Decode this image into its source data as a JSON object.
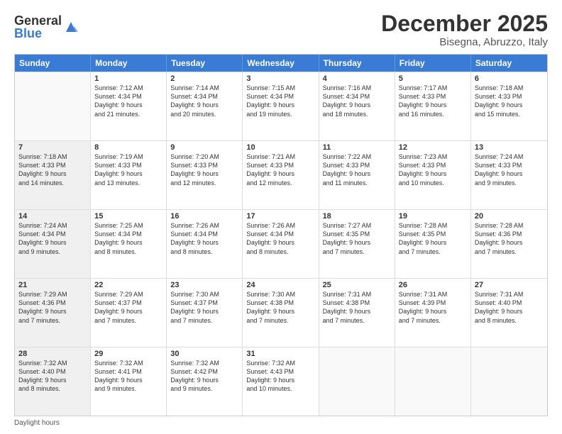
{
  "logo": {
    "general": "General",
    "blue": "Blue"
  },
  "title": "December 2025",
  "subtitle": "Bisegna, Abruzzo, Italy",
  "header_days": [
    "Sunday",
    "Monday",
    "Tuesday",
    "Wednesday",
    "Thursday",
    "Friday",
    "Saturday"
  ],
  "footer": "Daylight hours",
  "weeks": [
    [
      {
        "num": "",
        "info": "",
        "empty": true
      },
      {
        "num": "1",
        "info": "Sunrise: 7:12 AM\nSunset: 4:34 PM\nDaylight: 9 hours\nand 21 minutes."
      },
      {
        "num": "2",
        "info": "Sunrise: 7:14 AM\nSunset: 4:34 PM\nDaylight: 9 hours\nand 20 minutes."
      },
      {
        "num": "3",
        "info": "Sunrise: 7:15 AM\nSunset: 4:34 PM\nDaylight: 9 hours\nand 19 minutes."
      },
      {
        "num": "4",
        "info": "Sunrise: 7:16 AM\nSunset: 4:34 PM\nDaylight: 9 hours\nand 18 minutes."
      },
      {
        "num": "5",
        "info": "Sunrise: 7:17 AM\nSunset: 4:33 PM\nDaylight: 9 hours\nand 16 minutes."
      },
      {
        "num": "6",
        "info": "Sunrise: 7:18 AM\nSunset: 4:33 PM\nDaylight: 9 hours\nand 15 minutes."
      }
    ],
    [
      {
        "num": "7",
        "info": "Sunrise: 7:18 AM\nSunset: 4:33 PM\nDaylight: 9 hours\nand 14 minutes.",
        "shaded": true
      },
      {
        "num": "8",
        "info": "Sunrise: 7:19 AM\nSunset: 4:33 PM\nDaylight: 9 hours\nand 13 minutes."
      },
      {
        "num": "9",
        "info": "Sunrise: 7:20 AM\nSunset: 4:33 PM\nDaylight: 9 hours\nand 12 minutes."
      },
      {
        "num": "10",
        "info": "Sunrise: 7:21 AM\nSunset: 4:33 PM\nDaylight: 9 hours\nand 12 minutes."
      },
      {
        "num": "11",
        "info": "Sunrise: 7:22 AM\nSunset: 4:33 PM\nDaylight: 9 hours\nand 11 minutes."
      },
      {
        "num": "12",
        "info": "Sunrise: 7:23 AM\nSunset: 4:33 PM\nDaylight: 9 hours\nand 10 minutes."
      },
      {
        "num": "13",
        "info": "Sunrise: 7:24 AM\nSunset: 4:33 PM\nDaylight: 9 hours\nand 9 minutes."
      }
    ],
    [
      {
        "num": "14",
        "info": "Sunrise: 7:24 AM\nSunset: 4:34 PM\nDaylight: 9 hours\nand 9 minutes.",
        "shaded": true
      },
      {
        "num": "15",
        "info": "Sunrise: 7:25 AM\nSunset: 4:34 PM\nDaylight: 9 hours\nand 8 minutes."
      },
      {
        "num": "16",
        "info": "Sunrise: 7:26 AM\nSunset: 4:34 PM\nDaylight: 9 hours\nand 8 minutes."
      },
      {
        "num": "17",
        "info": "Sunrise: 7:26 AM\nSunset: 4:34 PM\nDaylight: 9 hours\nand 8 minutes."
      },
      {
        "num": "18",
        "info": "Sunrise: 7:27 AM\nSunset: 4:35 PM\nDaylight: 9 hours\nand 7 minutes."
      },
      {
        "num": "19",
        "info": "Sunrise: 7:28 AM\nSunset: 4:35 PM\nDaylight: 9 hours\nand 7 minutes."
      },
      {
        "num": "20",
        "info": "Sunrise: 7:28 AM\nSunset: 4:36 PM\nDaylight: 9 hours\nand 7 minutes."
      }
    ],
    [
      {
        "num": "21",
        "info": "Sunrise: 7:29 AM\nSunset: 4:36 PM\nDaylight: 9 hours\nand 7 minutes.",
        "shaded": true
      },
      {
        "num": "22",
        "info": "Sunrise: 7:29 AM\nSunset: 4:37 PM\nDaylight: 9 hours\nand 7 minutes."
      },
      {
        "num": "23",
        "info": "Sunrise: 7:30 AM\nSunset: 4:37 PM\nDaylight: 9 hours\nand 7 minutes."
      },
      {
        "num": "24",
        "info": "Sunrise: 7:30 AM\nSunset: 4:38 PM\nDaylight: 9 hours\nand 7 minutes."
      },
      {
        "num": "25",
        "info": "Sunrise: 7:31 AM\nSunset: 4:38 PM\nDaylight: 9 hours\nand 7 minutes."
      },
      {
        "num": "26",
        "info": "Sunrise: 7:31 AM\nSunset: 4:39 PM\nDaylight: 9 hours\nand 7 minutes."
      },
      {
        "num": "27",
        "info": "Sunrise: 7:31 AM\nSunset: 4:40 PM\nDaylight: 9 hours\nand 8 minutes."
      }
    ],
    [
      {
        "num": "28",
        "info": "Sunrise: 7:32 AM\nSunset: 4:40 PM\nDaylight: 9 hours\nand 8 minutes.",
        "shaded": true
      },
      {
        "num": "29",
        "info": "Sunrise: 7:32 AM\nSunset: 4:41 PM\nDaylight: 9 hours\nand 9 minutes."
      },
      {
        "num": "30",
        "info": "Sunrise: 7:32 AM\nSunset: 4:42 PM\nDaylight: 9 hours\nand 9 minutes."
      },
      {
        "num": "31",
        "info": "Sunrise: 7:32 AM\nSunset: 4:43 PM\nDaylight: 9 hours\nand 10 minutes."
      },
      {
        "num": "",
        "info": "",
        "empty": true
      },
      {
        "num": "",
        "info": "",
        "empty": true
      },
      {
        "num": "",
        "info": "",
        "empty": true
      }
    ]
  ]
}
